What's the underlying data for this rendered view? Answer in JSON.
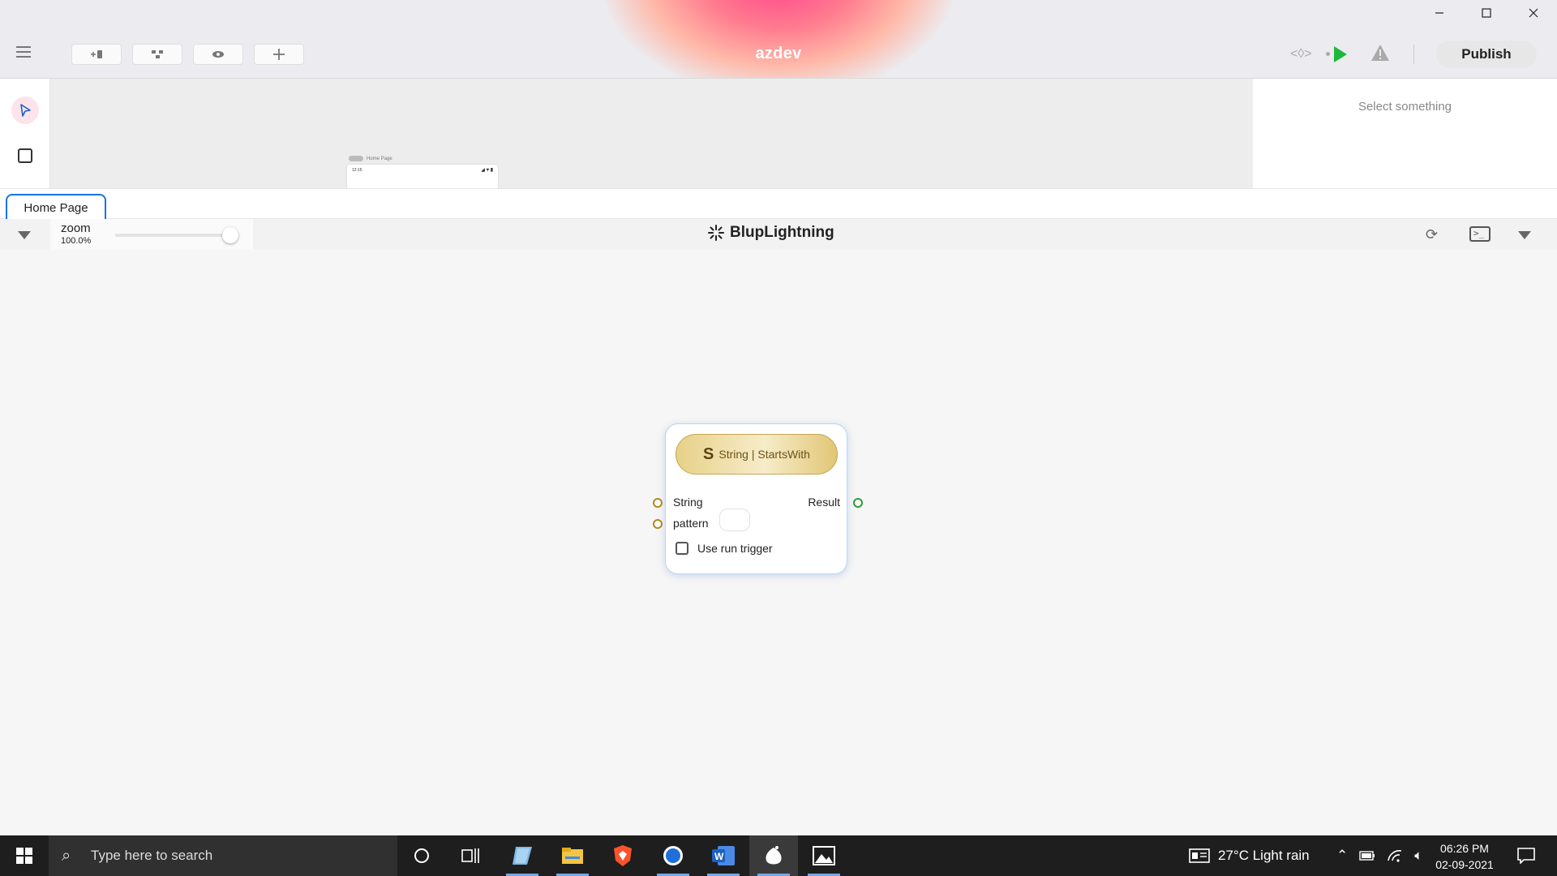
{
  "window": {
    "title": "azdev",
    "minimize_icon": "minimize-icon",
    "maximize_icon": "maximize-icon",
    "close_icon": "close-icon"
  },
  "toolbar": {
    "publish_label": "Publish",
    "buttons": [
      "add-screen-icon",
      "widget-tree-icon",
      "preview-eye-icon",
      "add-icon"
    ],
    "run_color": "#1fb83b"
  },
  "right_panel": {
    "hint": "Select something"
  },
  "mini_page": {
    "label": "Home Page",
    "time": "12:15"
  },
  "tabs": [
    {
      "label": "Home Page",
      "active": true
    }
  ],
  "logic_toolbar": {
    "zoom_label": "zoom",
    "zoom_value": "100.0%",
    "zoom_level": 1.0,
    "brand": "BlupLightning"
  },
  "node": {
    "header_icon": "S",
    "title": "String | StartsWith",
    "inputs": [
      "String",
      "pattern"
    ],
    "outputs": [
      "Result"
    ],
    "checkbox_label": "Use run trigger",
    "checkbox_checked": false,
    "accent": "#e7d189"
  },
  "taskbar": {
    "search_placeholder": "Type here to search",
    "weather": "27°C  Light rain",
    "time": "06:26 PM",
    "date": "02-09-2021"
  }
}
